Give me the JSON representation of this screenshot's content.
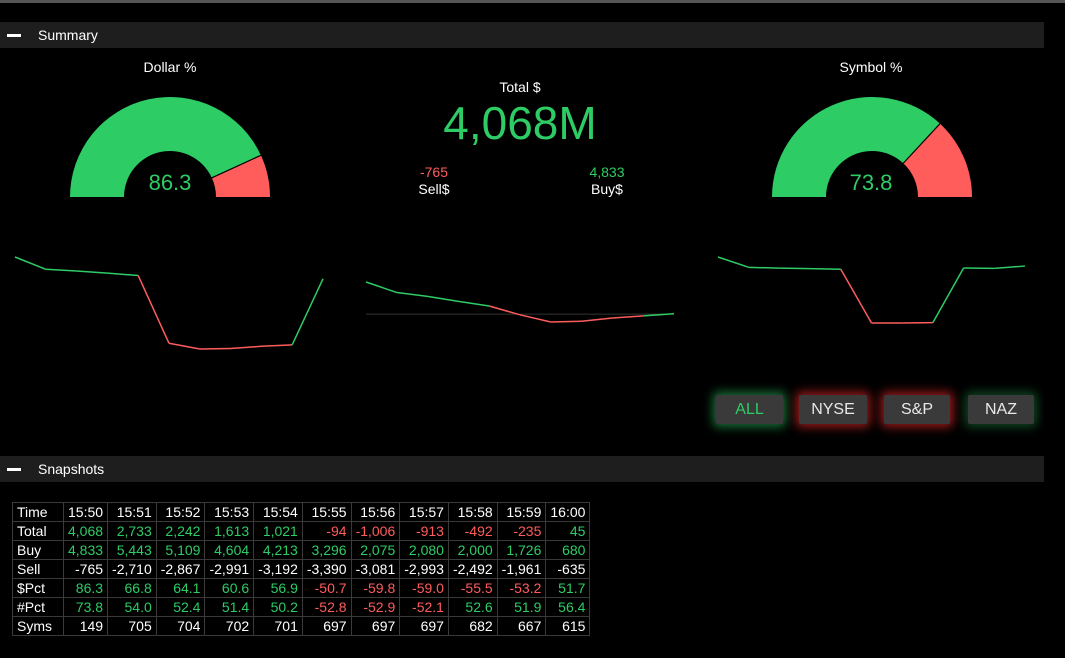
{
  "colors": {
    "positive": "#2ecc65",
    "negative": "#ff5c5c",
    "header_bg": "#1e1e1e"
  },
  "summary": {
    "title": "Summary",
    "dollar_gauge": {
      "label": "Dollar %",
      "value": "86.3",
      "percent": 86.3
    },
    "symbol_gauge": {
      "label": "Symbol %",
      "value": "73.8",
      "percent": 73.8
    },
    "total": {
      "label": "Total $",
      "value": "4,068M"
    },
    "sell": {
      "label": "Sell$",
      "value": "-765"
    },
    "buy": {
      "label": "Buy$",
      "value": "4,833"
    }
  },
  "sparklines": {
    "dollar_pct": [
      86.3,
      66.8,
      64.1,
      60.6,
      56.9,
      -50.7,
      -59.8,
      -59.0,
      -55.5,
      -53.2,
      51.7
    ],
    "total": [
      4068,
      2733,
      2242,
      1613,
      1021,
      -94,
      -1006,
      -913,
      -492,
      -235,
      45
    ],
    "symbol_pct": [
      73.8,
      54.0,
      52.4,
      51.4,
      50.2,
      -52.8,
      -52.9,
      -52.1,
      52.6,
      51.9,
      56.4
    ]
  },
  "filters": [
    {
      "label": "ALL"
    },
    {
      "label": "NYSE"
    },
    {
      "label": "S&P"
    },
    {
      "label": "NAZ"
    }
  ],
  "snapshots": {
    "title": "Snapshots",
    "times": [
      "15:50",
      "15:51",
      "15:52",
      "15:53",
      "15:54",
      "15:55",
      "15:56",
      "15:57",
      "15:58",
      "15:59",
      "16:00"
    ],
    "rows": [
      {
        "label": "Time",
        "colored": false,
        "values": [
          "15:50",
          "15:51",
          "15:52",
          "15:53",
          "15:54",
          "15:55",
          "15:56",
          "15:57",
          "15:58",
          "15:59",
          "16:00"
        ]
      },
      {
        "label": "Total",
        "colored": true,
        "values": [
          "4,068",
          "2,733",
          "2,242",
          "1,613",
          "1,021",
          "-94",
          "-1,006",
          "-913",
          "-492",
          "-235",
          "45"
        ]
      },
      {
        "label": "Buy",
        "colored": true,
        "values": [
          "4,833",
          "5,443",
          "5,109",
          "4,604",
          "4,213",
          "3,296",
          "2,075",
          "2,080",
          "2,000",
          "1,726",
          "680"
        ]
      },
      {
        "label": "Sell",
        "colored": false,
        "values": [
          "-765",
          "-2,710",
          "-2,867",
          "-2,991",
          "-3,192",
          "-3,390",
          "-3,081",
          "-2,993",
          "-2,492",
          "-1,961",
          "-635"
        ]
      },
      {
        "label": "$Pct",
        "colored": true,
        "values": [
          "86.3",
          "66.8",
          "64.1",
          "60.6",
          "56.9",
          "-50.7",
          "-59.8",
          "-59.0",
          "-55.5",
          "-53.2",
          "51.7"
        ]
      },
      {
        "label": "#Pct",
        "colored": true,
        "values": [
          "73.8",
          "54.0",
          "52.4",
          "51.4",
          "50.2",
          "-52.8",
          "-52.9",
          "-52.1",
          "52.6",
          "51.9",
          "56.4"
        ]
      },
      {
        "label": "Syms",
        "colored": false,
        "values": [
          "149",
          "705",
          "704",
          "702",
          "701",
          "697",
          "697",
          "697",
          "682",
          "667",
          "615"
        ]
      }
    ]
  }
}
